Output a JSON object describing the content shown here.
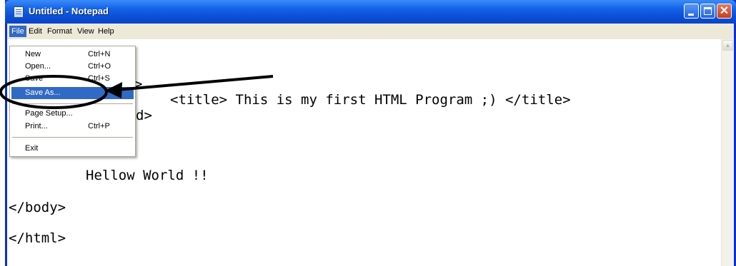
{
  "window": {
    "title": "Untitled - Notepad"
  },
  "menubar": {
    "items": [
      "File",
      "Edit",
      "Format",
      "View",
      "Help"
    ]
  },
  "file_menu": {
    "items": [
      {
        "label": "New",
        "shortcut": "Ctrl+N"
      },
      {
        "label": "Open...",
        "shortcut": "Ctrl+O"
      },
      {
        "label": "Save",
        "shortcut": "Ctrl+S"
      },
      {
        "label": "Save As...",
        "shortcut": ""
      },
      {
        "label": "Page Setup...",
        "shortcut": ""
      },
      {
        "label": "Print...",
        "shortcut": "Ctrl+P"
      },
      {
        "label": "Exit",
        "shortcut": ""
      }
    ],
    "highlighted": "Save As..."
  },
  "editor": {
    "visible_lines": [
      ">",
      "<title> This is my first HTML Program ;) </title>",
      "d>",
      "Hellow World !!",
      "</body>",
      "</html>"
    ]
  },
  "colors": {
    "titlebar": "#0a4fd6",
    "menu_highlight": "#316ac5",
    "menubar_bg": "#ece9d8",
    "annotation": "#000000"
  },
  "icons": {
    "app": "notepad-icon",
    "minimize": "minimize-icon",
    "maximize": "maximize-icon",
    "close": "close-icon",
    "scroll_up": "scroll-up-arrow-icon"
  }
}
